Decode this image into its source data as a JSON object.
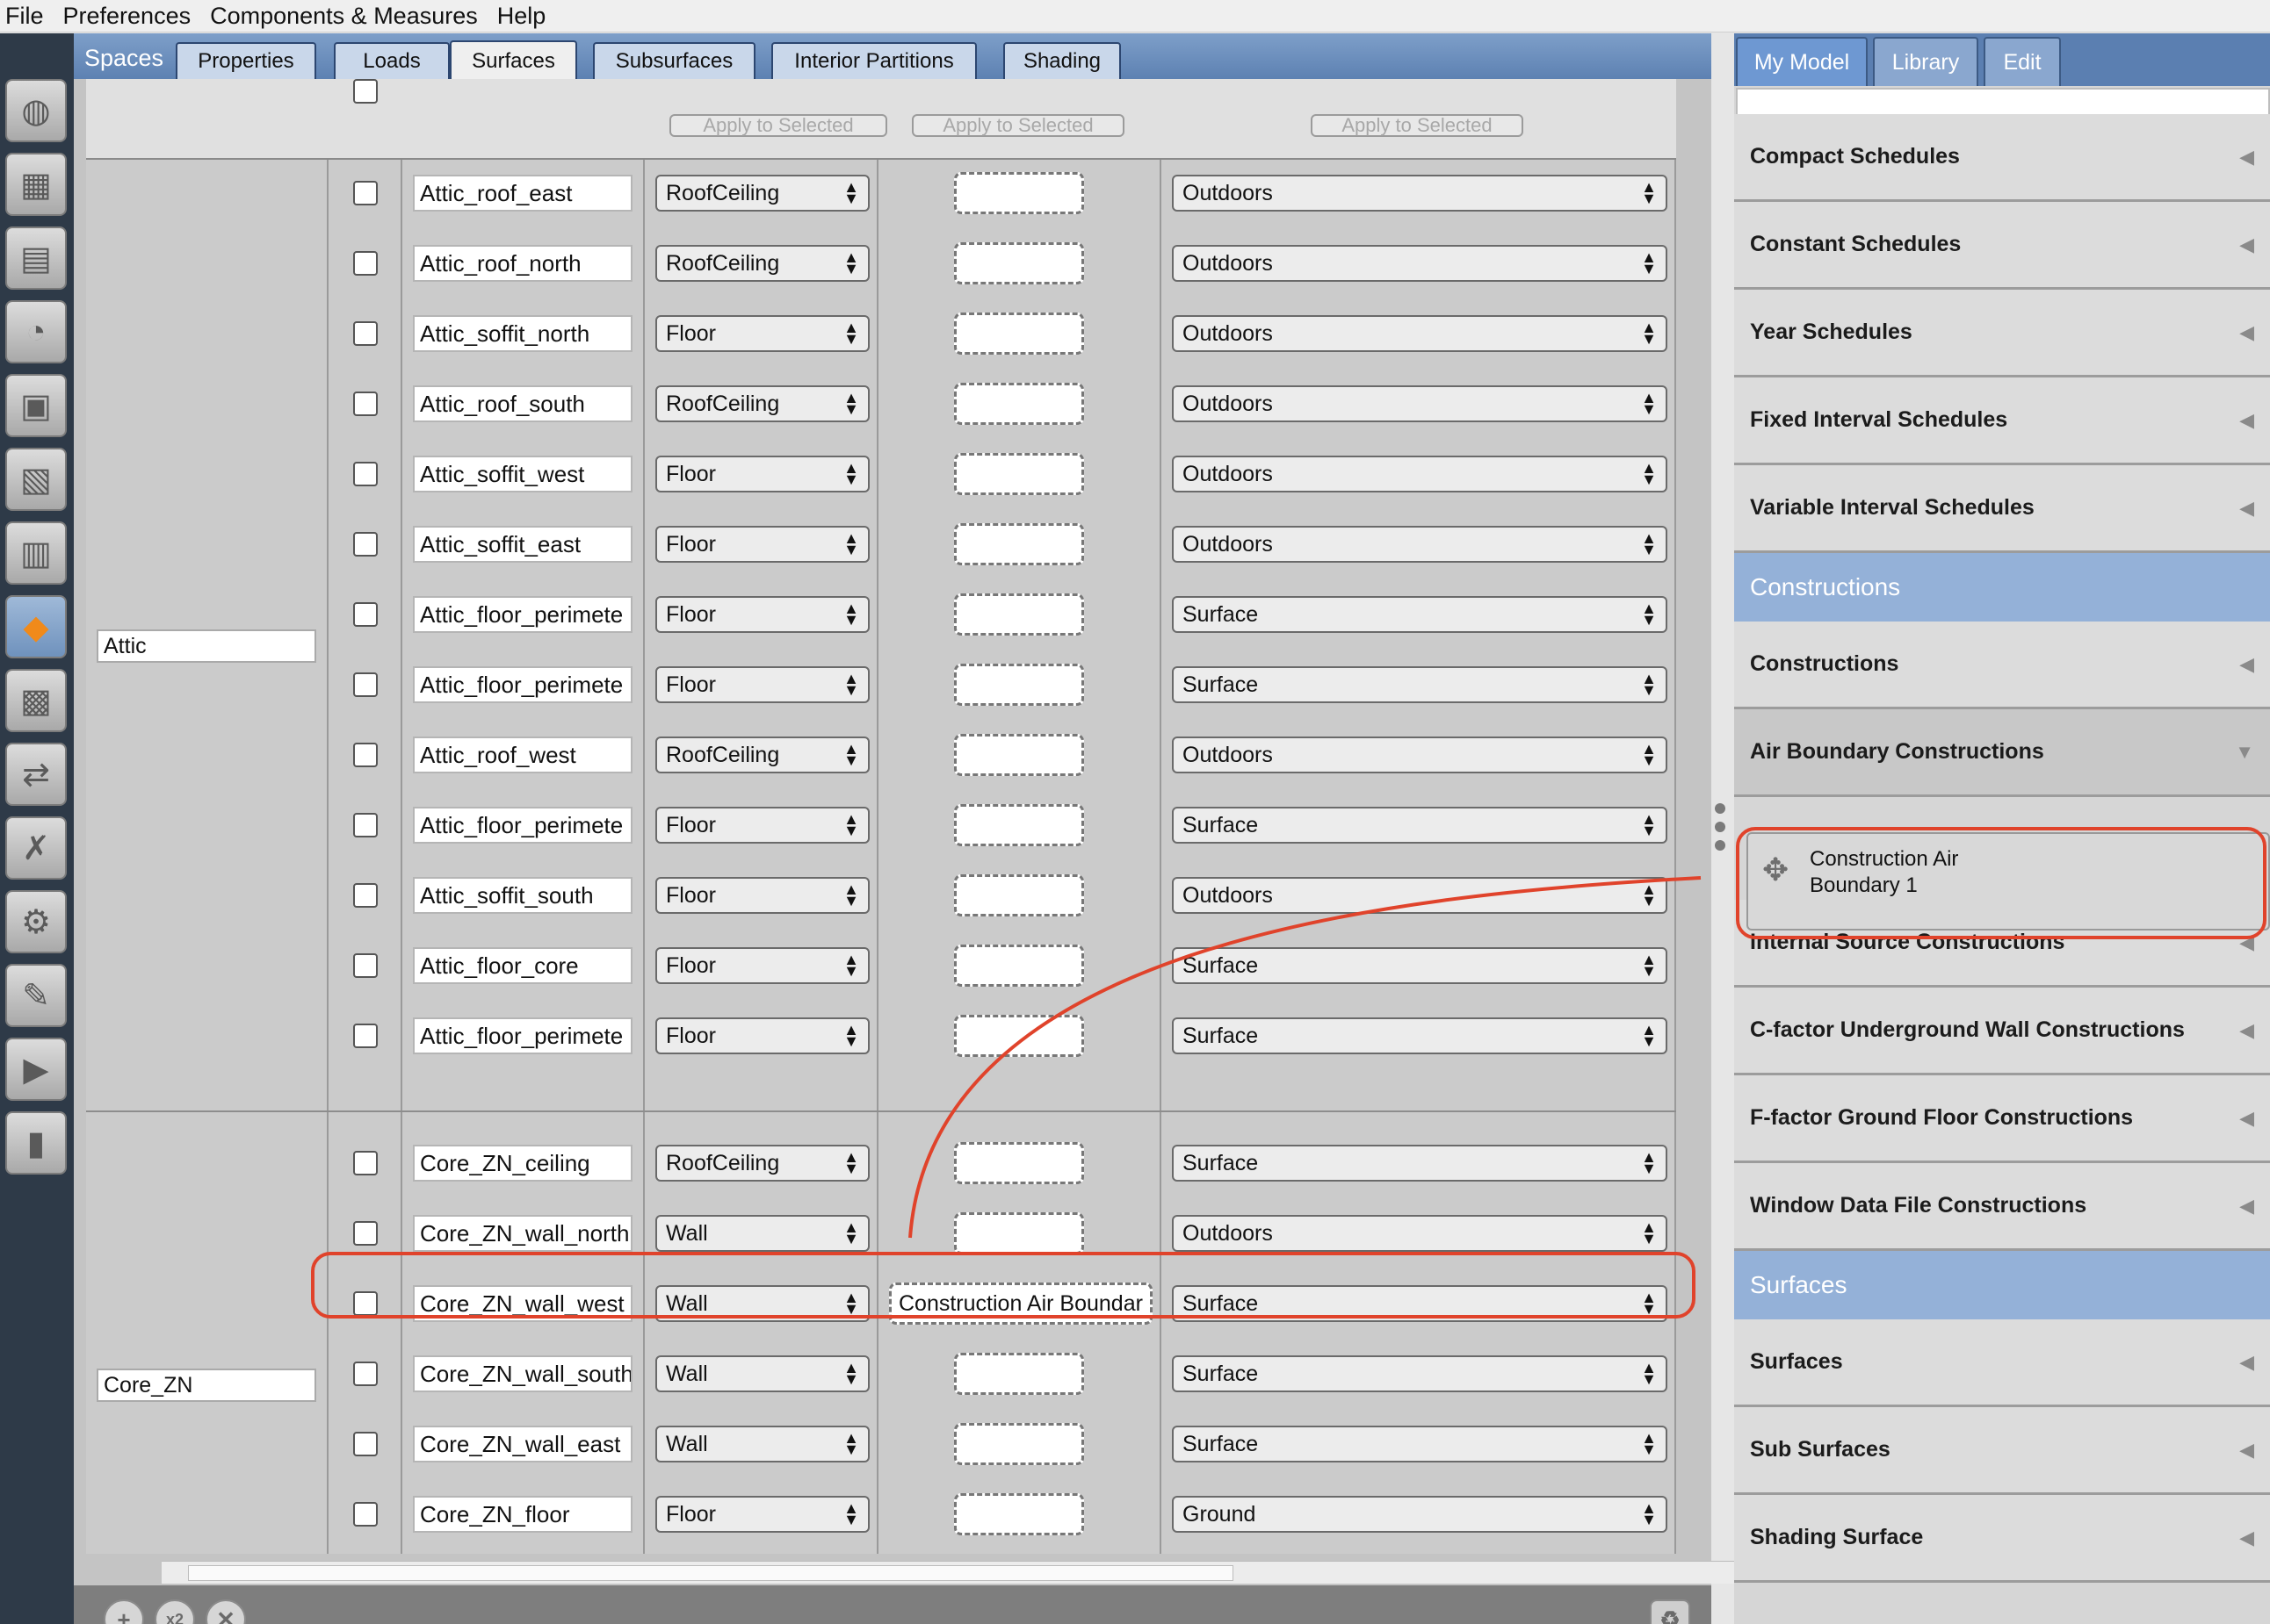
{
  "menu": [
    "File",
    "Preferences",
    "Components & Measures",
    "Help"
  ],
  "left_toolbar": [
    "site-icon",
    "schedules-icon",
    "constructions-icon",
    "loads-icon",
    "space-types-icon",
    "geometry-icon",
    "facility-icon",
    "spaces-icon",
    "thermal-zones-icon",
    "hvac-icon",
    "variables-icon",
    "simulation-settings-icon",
    "scripts-icon",
    "run-icon",
    "results-icon"
  ],
  "spaces_label": "Spaces",
  "tabs": [
    "Properties",
    "Loads",
    "Surfaces",
    "Subsurfaces",
    "Interior Partitions",
    "Shading"
  ],
  "selected_tab": "Surfaces",
  "apply_label": "Apply to Selected",
  "spaces": [
    {
      "name": "Attic"
    },
    {
      "name": "Core_ZN"
    }
  ],
  "surfaces": [
    {
      "name": "Attic_roof_east",
      "type": "RoofCeiling",
      "construction": "",
      "boundary": "Outdoors"
    },
    {
      "name": "Attic_roof_north",
      "type": "RoofCeiling",
      "construction": "",
      "boundary": "Outdoors"
    },
    {
      "name": "Attic_soffit_north",
      "type": "Floor",
      "construction": "",
      "boundary": "Outdoors"
    },
    {
      "name": "Attic_roof_south",
      "type": "RoofCeiling",
      "construction": "",
      "boundary": "Outdoors"
    },
    {
      "name": "Attic_soffit_west",
      "type": "Floor",
      "construction": "",
      "boundary": "Outdoors"
    },
    {
      "name": "Attic_soffit_east",
      "type": "Floor",
      "construction": "",
      "boundary": "Outdoors"
    },
    {
      "name": "Attic_floor_perimete",
      "type": "Floor",
      "construction": "",
      "boundary": "Surface"
    },
    {
      "name": "Attic_floor_perimete",
      "type": "Floor",
      "construction": "",
      "boundary": "Surface"
    },
    {
      "name": "Attic_roof_west",
      "type": "RoofCeiling",
      "construction": "",
      "boundary": "Outdoors"
    },
    {
      "name": "Attic_floor_perimete",
      "type": "Floor",
      "construction": "",
      "boundary": "Surface"
    },
    {
      "name": "Attic_soffit_south",
      "type": "Floor",
      "construction": "",
      "boundary": "Outdoors"
    },
    {
      "name": "Attic_floor_core",
      "type": "Floor",
      "construction": "",
      "boundary": "Surface"
    },
    {
      "name": "Attic_floor_perimete",
      "type": "Floor",
      "construction": "",
      "boundary": "Surface"
    },
    {
      "name": "Core_ZN_ceiling",
      "type": "RoofCeiling",
      "construction": "",
      "boundary": "Surface"
    },
    {
      "name": "Core_ZN_wall_north",
      "type": "Wall",
      "construction": "",
      "boundary": "Outdoors"
    },
    {
      "name": "Core_ZN_wall_west",
      "type": "Wall",
      "construction": "Construction Air Boundar",
      "boundary": "Surface"
    },
    {
      "name": "Core_ZN_wall_south",
      "type": "Wall",
      "construction": "",
      "boundary": "Surface"
    },
    {
      "name": "Core_ZN_wall_east",
      "type": "Wall",
      "construction": "",
      "boundary": "Surface"
    },
    {
      "name": "Core_ZN_floor",
      "type": "Floor",
      "construction": "",
      "boundary": "Ground"
    }
  ],
  "bottom_buttons": [
    "add-icon",
    "copy-icon",
    "delete-icon",
    "purge-icon"
  ],
  "right_tabs": [
    "My Model",
    "Library",
    "Edit"
  ],
  "selected_right_tab": "My Model",
  "search_value": "",
  "library_sections": [
    {
      "type": "category",
      "label": "Compact Schedules",
      "state": "collapsed"
    },
    {
      "type": "category",
      "label": "Constant Schedules",
      "state": "collapsed"
    },
    {
      "type": "category",
      "label": "Year Schedules",
      "state": "collapsed"
    },
    {
      "type": "category",
      "label": "Fixed Interval Schedules",
      "state": "collapsed"
    },
    {
      "type": "category",
      "label": "Variable Interval Schedules",
      "state": "collapsed"
    },
    {
      "type": "header",
      "label": "Constructions"
    },
    {
      "type": "category",
      "label": "Constructions",
      "state": "collapsed"
    },
    {
      "type": "category",
      "label": "Air Boundary Constructions",
      "state": "expanded"
    },
    {
      "type": "category",
      "label": "Internal Source Constructions",
      "state": "collapsed"
    },
    {
      "type": "category",
      "label": "C-factor Underground Wall Constructions",
      "state": "collapsed"
    },
    {
      "type": "category",
      "label": "F-factor Ground Floor Constructions",
      "state": "collapsed"
    },
    {
      "type": "category",
      "label": "Window Data File Constructions",
      "state": "collapsed"
    },
    {
      "type": "header",
      "label": "Surfaces"
    },
    {
      "type": "category",
      "label": "Surfaces",
      "state": "collapsed"
    },
    {
      "type": "category",
      "label": "Sub Surfaces",
      "state": "collapsed"
    },
    {
      "type": "category",
      "label": "Shading Surface",
      "state": "collapsed"
    }
  ],
  "library_item": {
    "line1": "Construction Air",
    "line2": "Boundary 1"
  },
  "annotation_color": "#e0432b"
}
